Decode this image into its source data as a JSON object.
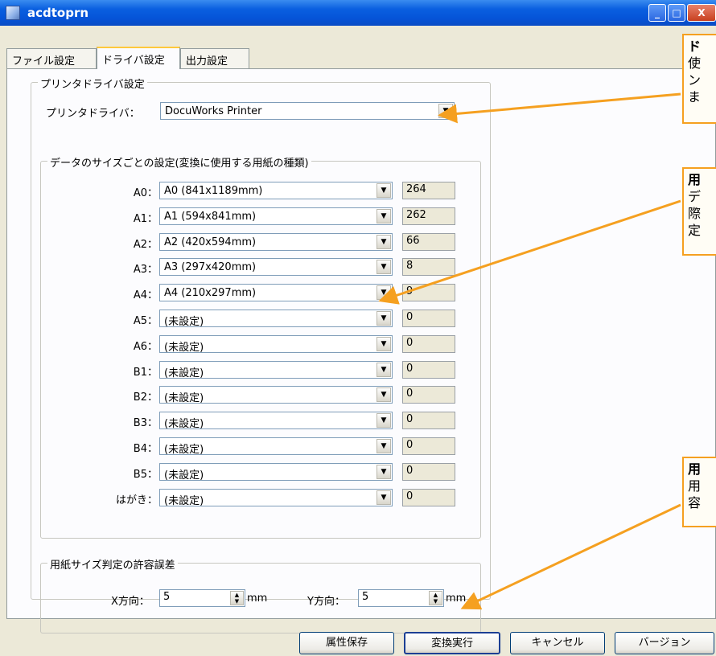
{
  "window": {
    "title": "acdtoprn",
    "buttons": {
      "minimize": "_",
      "maximize": "□",
      "close": "X"
    }
  },
  "tabs": [
    {
      "label": "ファイル設定"
    },
    {
      "label": "ドライバ設定"
    },
    {
      "label": "出力設定"
    }
  ],
  "printer_group": {
    "legend": "プリンタドライバ設定",
    "driver_label": "プリンタドライバ：",
    "driver_value": "DocuWorks Printer"
  },
  "size_group": {
    "legend": "データのサイズごとの設定(変換に使用する用紙の種類)",
    "rows": [
      {
        "label": "A0：",
        "paper": "A0 (841x1189mm)",
        "count": "264"
      },
      {
        "label": "A1：",
        "paper": "A1 (594x841mm)",
        "count": "262"
      },
      {
        "label": "A2：",
        "paper": "A2 (420x594mm)",
        "count": "66"
      },
      {
        "label": "A3：",
        "paper": "A3 (297x420mm)",
        "count": "8"
      },
      {
        "label": "A4：",
        "paper": "A4 (210x297mm)",
        "count": "9"
      },
      {
        "label": "A5：",
        "paper": "(未設定)",
        "count": "0"
      },
      {
        "label": "A6：",
        "paper": "(未設定)",
        "count": "0"
      },
      {
        "label": "B1：",
        "paper": "(未設定)",
        "count": "0"
      },
      {
        "label": "B2：",
        "paper": "(未設定)",
        "count": "0"
      },
      {
        "label": "B3：",
        "paper": "(未設定)",
        "count": "0"
      },
      {
        "label": "B4：",
        "paper": "(未設定)",
        "count": "0"
      },
      {
        "label": "B5：",
        "paper": "(未設定)",
        "count": "0"
      },
      {
        "label": "はがき：",
        "paper": "(未設定)",
        "count": "0"
      }
    ]
  },
  "tolerance_group": {
    "legend": "用紙サイズ判定の許容誤差",
    "x_label": "X方向：",
    "x_value": "5",
    "x_unit": "mm",
    "y_label": "Y方向：",
    "y_value": "5",
    "y_unit": "mm"
  },
  "buttons": {
    "save_attr": "属性保存",
    "convert": "変換実行",
    "cancel": "キャンセル",
    "version": "バージョン"
  },
  "callouts": [
    {
      "heading": "ド",
      "lines": [
        "使",
        "ン",
        "ま"
      ]
    },
    {
      "heading": "用",
      "lines": [
        "デ",
        "際",
        "定"
      ]
    },
    {
      "heading": "用",
      "lines": [
        "用",
        "容"
      ]
    }
  ],
  "colors": {
    "accent_callout": "#f5a020",
    "titlebar": "#0554d8"
  }
}
